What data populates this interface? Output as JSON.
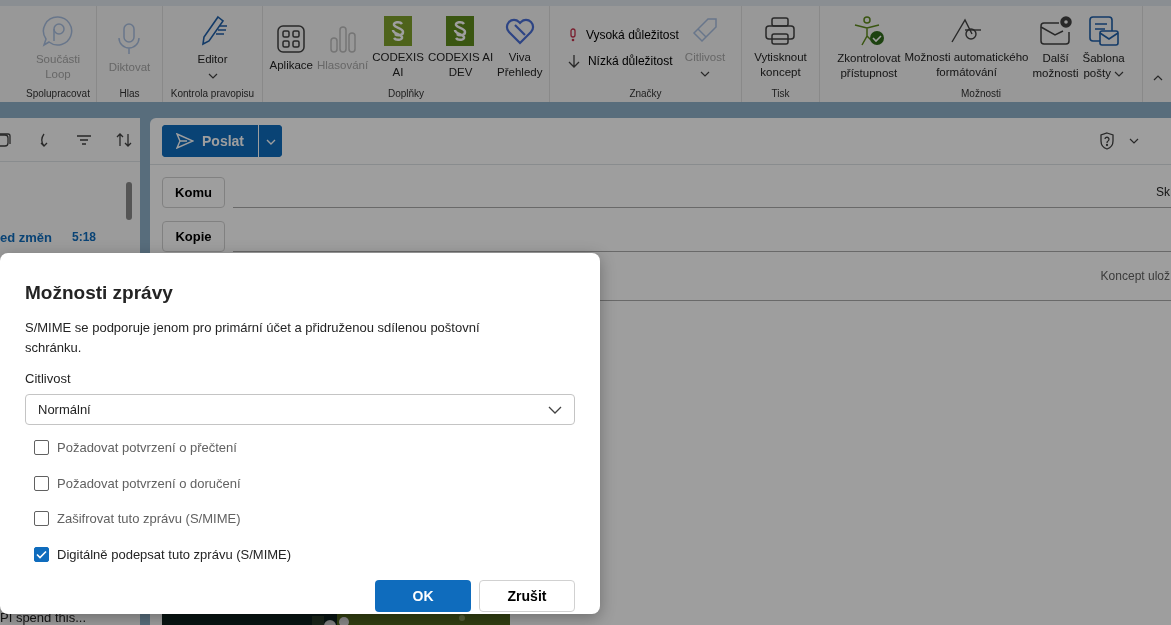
{
  "ribbon": {
    "groups": [
      {
        "label": "Spolupracovat",
        "items": [
          {
            "label": "Součásti\nLoop",
            "kind": "loop",
            "disabled": true,
            "dropdown": false
          }
        ]
      },
      {
        "label": "Hlas",
        "items": [
          {
            "label": "Diktovat",
            "kind": "mic",
            "disabled": true,
            "dropdown": false
          }
        ]
      },
      {
        "label": "Kontrola pravopisu",
        "items": [
          {
            "label": "Editor",
            "kind": "pen",
            "disabled": false,
            "dropdown": true
          }
        ]
      },
      {
        "label": "Doplňky",
        "items": [
          {
            "label": "Aplikace",
            "kind": "apps",
            "disabled": false,
            "dropdown": false
          },
          {
            "label": "Hlasování",
            "kind": "poll",
            "disabled": true,
            "dropdown": false
          },
          {
            "label": "CODEXIS\nAI",
            "kind": "codexis",
            "disabled": false,
            "dropdown": false
          },
          {
            "label": "CODEXIS AI\nDEV",
            "kind": "codexisdev",
            "disabled": false,
            "dropdown": false
          },
          {
            "label": "Viva\nPřehledy",
            "kind": "viva",
            "disabled": false,
            "dropdown": false
          }
        ]
      },
      {
        "label": "Značky",
        "items": [
          {
            "label": "Vysoká důležitost",
            "kind": "high",
            "disabled": false,
            "dropdown": false
          },
          {
            "label": "Nízká důležitost",
            "kind": "low",
            "disabled": false,
            "dropdown": false
          },
          {
            "label": "Citlivost",
            "kind": "tag",
            "disabled": true,
            "dropdown": true
          }
        ]
      },
      {
        "label": "Tisk",
        "items": [
          {
            "label": "Vytisknout\nkoncept",
            "kind": "printer",
            "disabled": false,
            "dropdown": false
          }
        ]
      },
      {
        "label": "Možnosti",
        "items": [
          {
            "label": "Zkontrolovat\npřístupnost",
            "kind": "access",
            "disabled": false,
            "dropdown": false
          },
          {
            "label": "Možnosti automatického\nformátování",
            "kind": "format",
            "disabled": false,
            "dropdown": false
          },
          {
            "label": "Další\nmožnosti",
            "kind": "mailgear",
            "disabled": false,
            "dropdown": false
          },
          {
            "label": "Šablona\npošty",
            "kind": "template",
            "disabled": false,
            "dropdown": true
          }
        ]
      }
    ]
  },
  "message_list": {
    "items": [
      {
        "subject": "ed změn",
        "time": "5:18"
      }
    ],
    "footer_preview": "PI spend this..."
  },
  "compose": {
    "send_button": "Poslat",
    "to_button": "Komu",
    "cc_button": "Kopie",
    "to_right_text": "Sk",
    "draft_status": "Koncept ulož"
  },
  "dialog": {
    "title": "Možnosti zprávy",
    "note": "S/MIME se podporuje jenom pro primární účet a přidruženou sdílenou poštovní schránku.",
    "sensitivity_label": "Citlivost",
    "sensitivity_value": "Normální",
    "options": [
      {
        "label": "Požadovat potvrzení o přečtení",
        "checked": false
      },
      {
        "label": "Požadovat potvrzení o doručení",
        "checked": false
      },
      {
        "label": "Zašifrovat tuto zprávu (S/MIME)",
        "checked": false
      },
      {
        "label": "Digitálně podepsat tuto zprávu (S/MIME)",
        "checked": true
      }
    ],
    "ok_button": "OK",
    "cancel_button": "Zrušit"
  }
}
